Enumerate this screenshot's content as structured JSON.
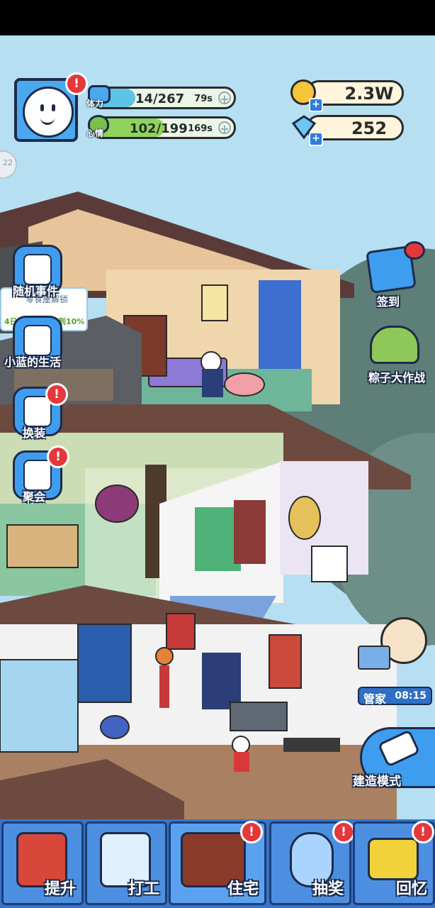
{
  "player": {
    "badge": "!"
  },
  "stats": {
    "stamina": {
      "label": "体力",
      "value": "14/267",
      "timer": "79s",
      "fill": 0.3
    },
    "mood": {
      "label": "心情",
      "value": "102/199",
      "timer": "169s",
      "fill": 0.51
    }
  },
  "currency": {
    "coins": "2.3W",
    "gems": "252"
  },
  "side_tab": "22",
  "left_menu": [
    {
      "label": "随机事件",
      "icon": "notebook-icon"
    },
    {
      "label": "小蓝的生活",
      "icon": "life-book-icon"
    },
    {
      "label": "换装",
      "icon": "shirt-icon",
      "badge": "!"
    },
    {
      "label": "聚会",
      "icon": "party-popper-icon",
      "badge": "!"
    }
  ],
  "event_banner": {
    "line1": "零食屋解锁",
    "line2": "4日",
    "line3": "到10%"
  },
  "right_menu": [
    {
      "label": "签到",
      "icon": "gift-box-icon"
    },
    {
      "label": "粽子大作战",
      "icon": "zongzi-icon"
    }
  ],
  "butler": {
    "label": "管家",
    "time": "08:15"
  },
  "build_mode": {
    "label": "建造模式"
  },
  "nav": [
    {
      "label": "提升",
      "icon": "upgrade-book-icon",
      "badge": ""
    },
    {
      "label": "打工",
      "icon": "work-badge-icon",
      "badge": ""
    },
    {
      "label": "住宅",
      "icon": "house-room-icon",
      "badge": "!"
    },
    {
      "label": "抽奖",
      "icon": "gacha-machine-icon",
      "badge": "!"
    },
    {
      "label": "回忆",
      "icon": "camera-icon",
      "badge": "!"
    }
  ],
  "colors": {
    "sky": "#b6dff2",
    "nav_blue": "#4c8fe0",
    "stamina": "#5fc3e8",
    "mood": "#8ed45a",
    "badge": "#e4383b"
  }
}
